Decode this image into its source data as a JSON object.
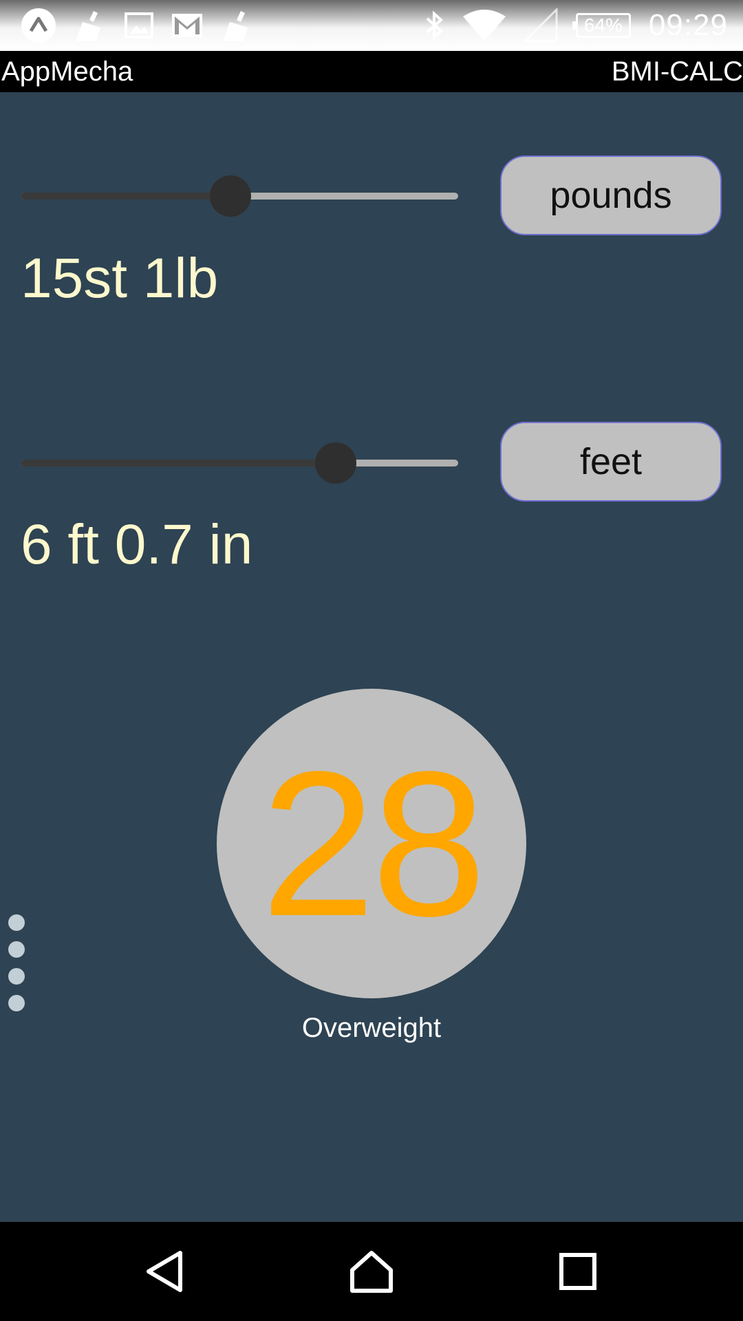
{
  "status_bar": {
    "battery_percent": "64%",
    "time": "09:29",
    "notification_icons": [
      "app-icon",
      "cleaner-icon",
      "image-icon",
      "gmail-icon",
      "cleaner-icon"
    ],
    "system_icons": [
      "bluetooth-icon",
      "wifi-icon",
      "signal-icon",
      "battery-icon"
    ]
  },
  "app_bar": {
    "app_name": "AppMecha",
    "title": "BMI-CALC"
  },
  "weight": {
    "slider_fraction": 0.48,
    "unit_button_label": "pounds",
    "reading": "15st 1lb"
  },
  "height": {
    "slider_fraction": 0.72,
    "unit_button_label": "feet",
    "reading": "6 ft 0.7 in"
  },
  "result": {
    "bmi": "28",
    "category": "Overweight"
  },
  "colors": {
    "background": "#2e4353",
    "reading_text": "#fdf8cd",
    "bmi_value": "#ffa600",
    "circle": "#c0c0c0",
    "button_border": "#6f6fd0"
  },
  "nav_bar": {
    "buttons": [
      "back-icon",
      "home-icon",
      "recents-icon"
    ]
  }
}
